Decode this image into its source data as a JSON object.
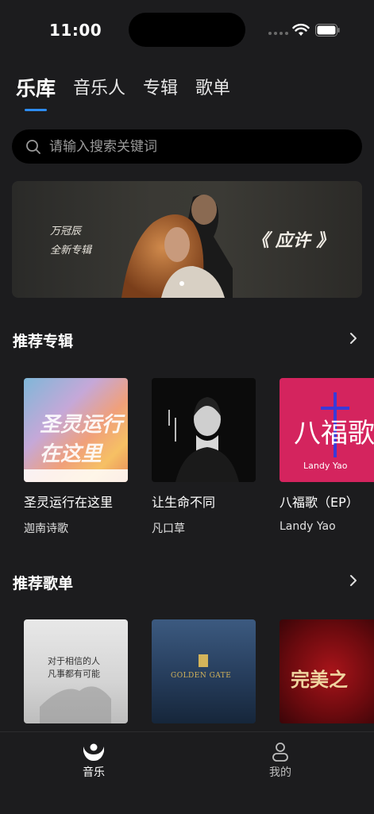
{
  "status_bar": {
    "time": "11:00"
  },
  "tabs": [
    {
      "label": "乐库",
      "active": true
    },
    {
      "label": "音乐人",
      "active": false
    },
    {
      "label": "专辑",
      "active": false
    },
    {
      "label": "歌单",
      "active": false
    }
  ],
  "search": {
    "placeholder": "请输入搜索关键词"
  },
  "banner": {
    "artist": "万冠辰",
    "subtitle": "全新专辑",
    "title": "《 应许 》"
  },
  "recommended_albums": {
    "title": "推荐专辑",
    "items": [
      {
        "title": "圣灵运行在这里",
        "artist": "迦南诗歌",
        "cover_text": "圣灵运行在这里"
      },
      {
        "title": "让生命不同",
        "artist": "凡口草",
        "cover_text": ""
      },
      {
        "title": "八福歌（EP）",
        "artist": "Landy Yao",
        "cover_text": "八福歌",
        "cover_name": "Landy Yao"
      }
    ]
  },
  "recommended_playlists": {
    "title": "推荐歌单",
    "items": [
      {
        "cover_line1": "对于相信的人",
        "cover_line2": "凡事都有可能"
      },
      {
        "cover_text": "GOLDEN GATE"
      },
      {
        "cover_text": "完美之"
      }
    ]
  },
  "bottom_nav": [
    {
      "label": "音乐",
      "active": true
    },
    {
      "label": "我的",
      "active": false
    }
  ],
  "colors": {
    "accent": "#2d8cf0",
    "background": "#1c1c1e"
  }
}
